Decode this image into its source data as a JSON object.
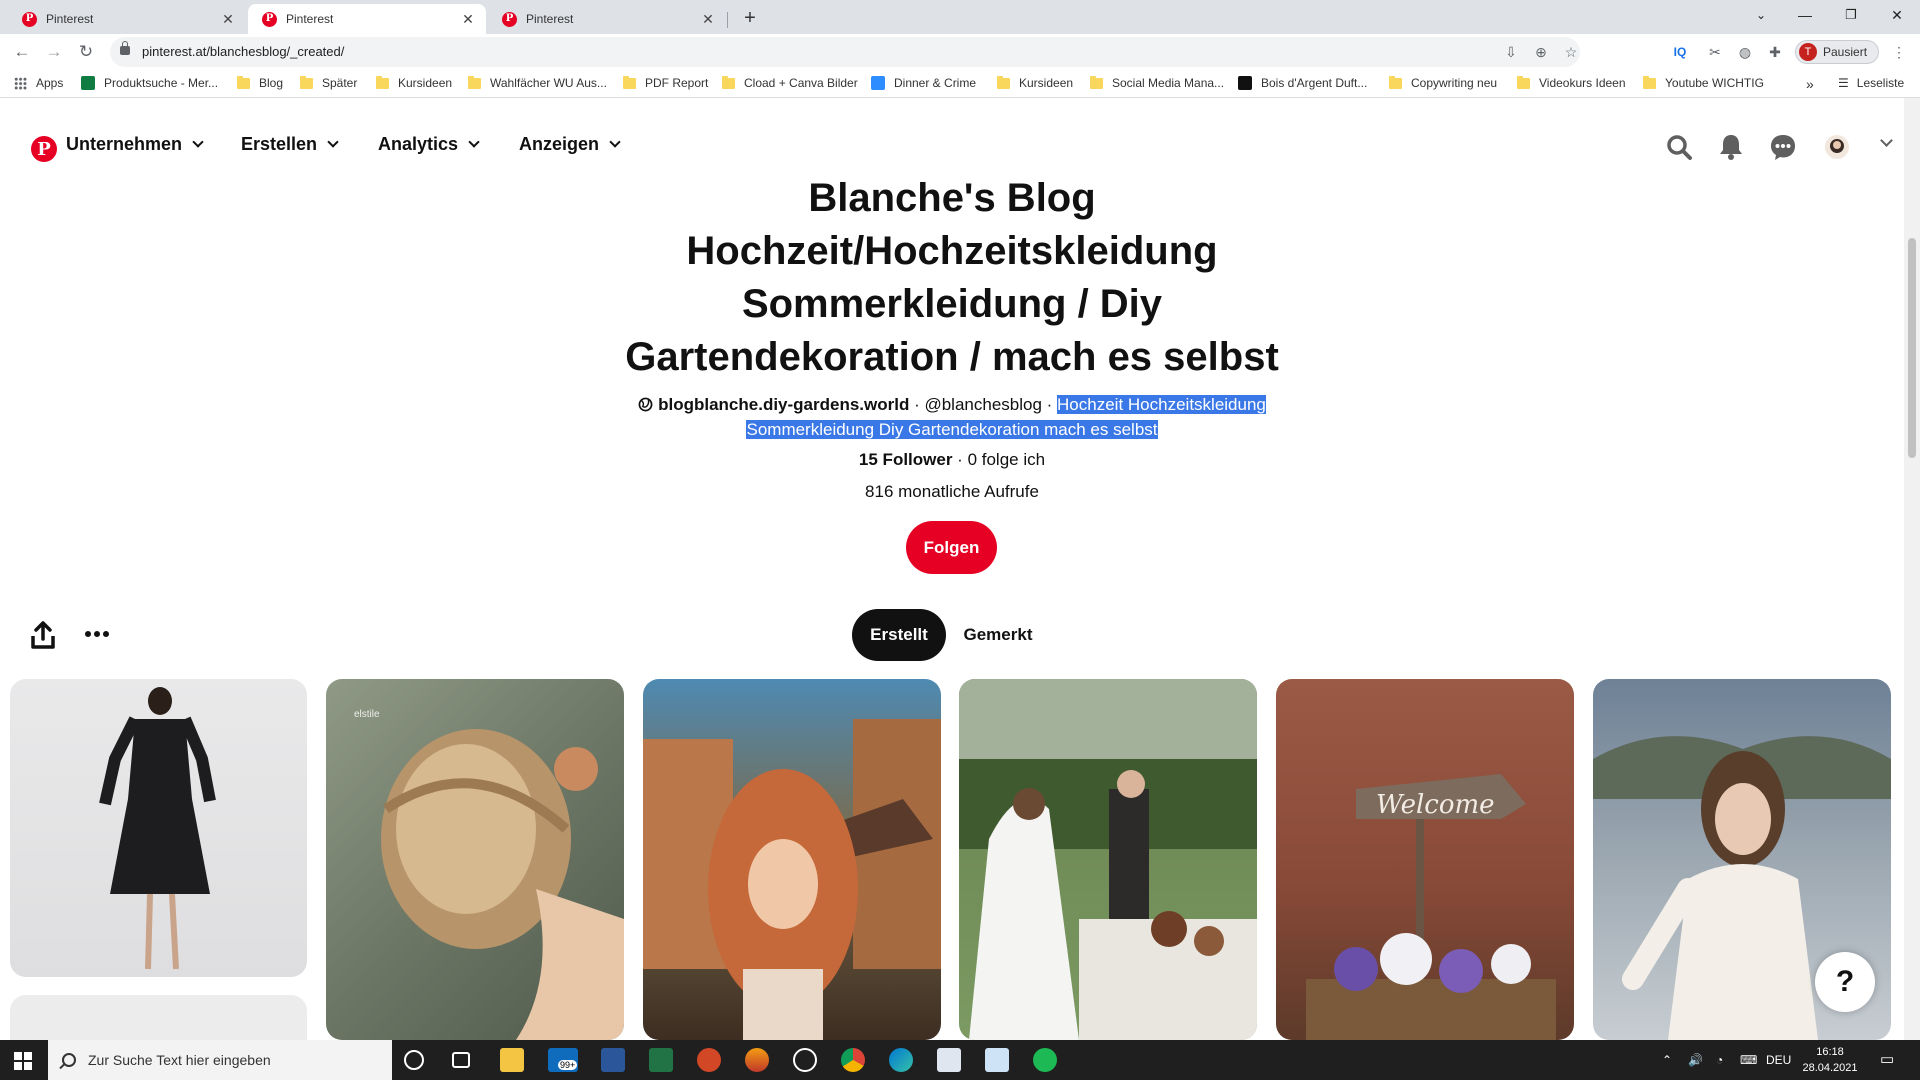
{
  "browser": {
    "tabs": [
      {
        "label": "Pinterest",
        "active": false
      },
      {
        "label": "Pinterest",
        "active": true
      },
      {
        "label": "Pinterest",
        "active": false
      }
    ],
    "url": "pinterest.at/blanchesblog/_created/",
    "profile_status": "Pausiert",
    "profile_initial": "T",
    "bookmarks": [
      {
        "label": "Apps",
        "icon": "apps-grid-icon"
      },
      {
        "label": "Produktsuche - Mer...",
        "icon": "site-icon"
      },
      {
        "label": "Blog",
        "icon": "folder-icon"
      },
      {
        "label": "Später",
        "icon": "folder-icon"
      },
      {
        "label": "Kursideen",
        "icon": "folder-icon"
      },
      {
        "label": "Wahlfächer WU Aus...",
        "icon": "folder-icon"
      },
      {
        "label": "PDF Report",
        "icon": "folder-icon"
      },
      {
        "label": "Cload + Canva Bilder",
        "icon": "folder-icon"
      },
      {
        "label": "Dinner & Crime",
        "icon": "site-icon"
      },
      {
        "label": "Kursideen",
        "icon": "folder-icon"
      },
      {
        "label": "Social Media Mana...",
        "icon": "folder-icon"
      },
      {
        "label": "Bois d'Argent Duft...",
        "icon": "site-icon"
      },
      {
        "label": "Copywriting neu",
        "icon": "folder-icon"
      },
      {
        "label": "Videokurs Ideen",
        "icon": "folder-icon"
      },
      {
        "label": "Youtube WICHTIG",
        "icon": "folder-icon"
      }
    ],
    "bookmarks_overflow": "»",
    "reading_list": "Leseliste"
  },
  "header": {
    "nav": [
      "Unternehmen",
      "Erstellen",
      "Analytics",
      "Anzeigen"
    ]
  },
  "profile": {
    "title_lines": [
      "Blanche's Blog",
      "Hochzeit/Hochzeitskleidung",
      "Sommerkleidung / Diy",
      "Gartendekoration / mach es selbst"
    ],
    "website": "blogblanche.diy-gardens.world",
    "handle": "@blanchesblog",
    "separator": " · ",
    "description_line1": "Hochzeit Hochzeitskleidung",
    "description_line2": "Sommerkleidung Diy Gartendekoration mach es selbst",
    "followers": "15 Follower",
    "following": "0 folge ich",
    "monthly_views": "816 monatliche Aufrufe",
    "follow_label": "Folgen",
    "tabs": [
      "Erstellt",
      "Gemerkt"
    ]
  },
  "pins": {
    "watermark": "elstile",
    "help_label": "?"
  },
  "taskbar": {
    "search_placeholder": "Zur Suche Text hier eingeben",
    "badge": "99+",
    "language": "DEU",
    "time": "16:18",
    "date": "28.04.2021"
  },
  "colors": {
    "pinterest_red": "#e60023",
    "selection_blue": "#3b78e7"
  }
}
